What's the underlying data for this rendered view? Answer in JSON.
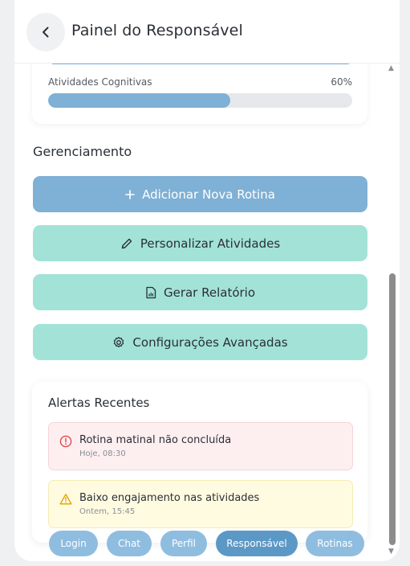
{
  "header": {
    "title": "Painel do Responsável",
    "back_icon": "chevron-left-icon"
  },
  "progress": [
    {
      "label": "Atividades Cognitivas",
      "value_text": "60%",
      "percent": 60
    }
  ],
  "management": {
    "title": "Gerenciamento",
    "buttons": [
      {
        "label": "Adicionar Nova Rotina",
        "icon": "plus-icon",
        "style": "primary"
      },
      {
        "label": "Personalizar Atividades",
        "icon": "pencil-icon",
        "style": "teal"
      },
      {
        "label": "Gerar Relatório",
        "icon": "report-icon",
        "style": "teal"
      },
      {
        "label": "Configurações Avançadas",
        "icon": "gear-icon",
        "style": "teal"
      }
    ]
  },
  "alerts": {
    "title": "Alertas Recentes",
    "items": [
      {
        "text": "Rotina matinal não concluída",
        "time": "Hoje, 08:30",
        "icon": "error-circle-icon",
        "color": "#e5484d"
      },
      {
        "text": "Baixo engajamento nas atividades",
        "time": "Ontem, 15:45",
        "icon": "warning-triangle-icon",
        "color": "#e0a400"
      }
    ]
  },
  "nav": {
    "items": [
      "Login",
      "Chat",
      "Perfil",
      "Responsável",
      "Rotinas"
    ],
    "active": "Responsável"
  },
  "colors": {
    "primary": "#7fb0d5",
    "teal": "#a3e3d7",
    "nav_pill": "#8fbde0",
    "nav_active": "#5c98c6"
  }
}
